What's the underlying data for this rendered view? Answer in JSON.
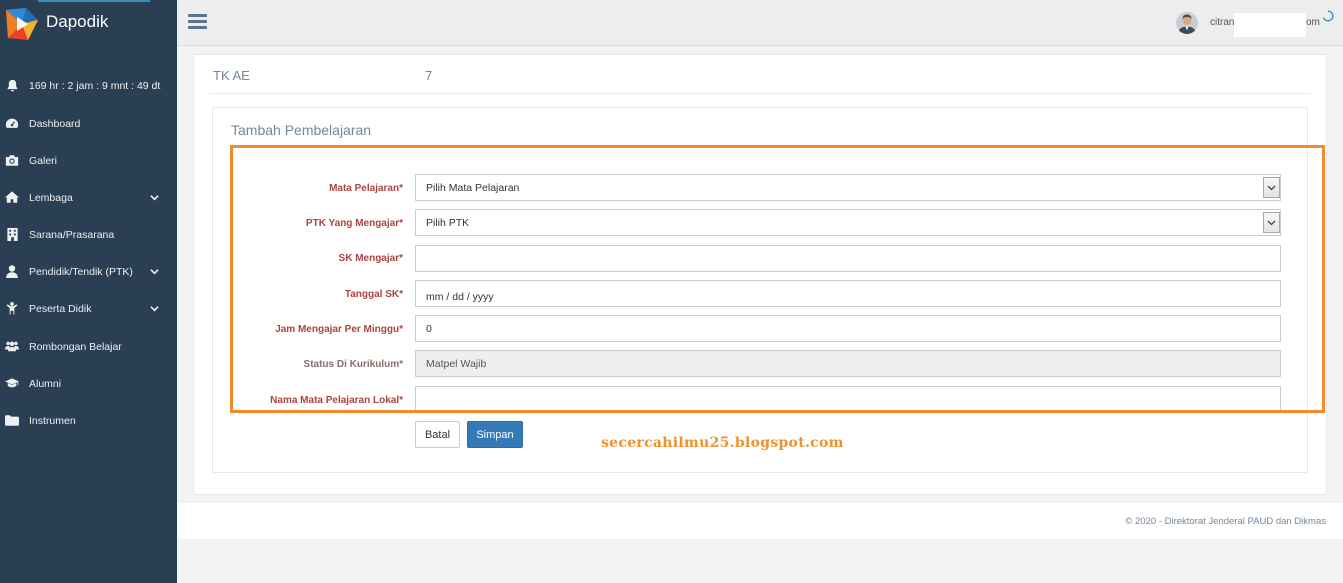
{
  "brand": {
    "name": "Dapodik"
  },
  "sidebar": {
    "timer": "169 hr : 2 jam : 9 mnt : 49 dt",
    "items": [
      {
        "label": "Dashboard"
      },
      {
        "label": "Galeri"
      },
      {
        "label": "Lembaga"
      },
      {
        "label": "Sarana/Prasarana"
      },
      {
        "label": "Pendidik/Tendik (PTK)"
      },
      {
        "label": "Peserta Didik"
      },
      {
        "label": "Rombongan Belajar"
      },
      {
        "label": "Alumni"
      },
      {
        "label": "Instrumen"
      }
    ]
  },
  "topbar": {
    "user_prefix": "citran",
    "user_suffix": "om"
  },
  "school": {
    "name": "TK AE",
    "npsn": "7"
  },
  "panel": {
    "title": "Tambah Pembelajaran"
  },
  "form": {
    "mata_pelajaran": {
      "label": "Mata Pelajaran*",
      "value": "Pilih Mata Pelajaran"
    },
    "ptk": {
      "label": "PTK Yang Mengajar*",
      "value": "Pilih PTK"
    },
    "sk_mengajar": {
      "label": "SK Mengajar*",
      "value": ""
    },
    "tanggal_sk": {
      "label": "Tanggal SK*",
      "value": "mm / dd / yyyy"
    },
    "jam_mengajar": {
      "label": "Jam Mengajar Per Minggu*",
      "value": "0"
    },
    "status_kurikulum": {
      "label": "Status Di Kurikulum*",
      "value": "Matpel Wajib"
    },
    "nama_lokal": {
      "label": "Nama Mata Pelajaran Lokal*",
      "value": ""
    }
  },
  "buttons": {
    "batal": "Batal",
    "simpan": "Simpan"
  },
  "watermark": "secercahilmu25.blogspot.com",
  "footer": {
    "text": "©   2020 - Direktorat Jenderal PAUD dan Dikmas"
  },
  "colors": {
    "sidebar": "#2a3f54",
    "primary": "#337ab7",
    "highlight": "#f58a2c",
    "label": "#a94442"
  }
}
